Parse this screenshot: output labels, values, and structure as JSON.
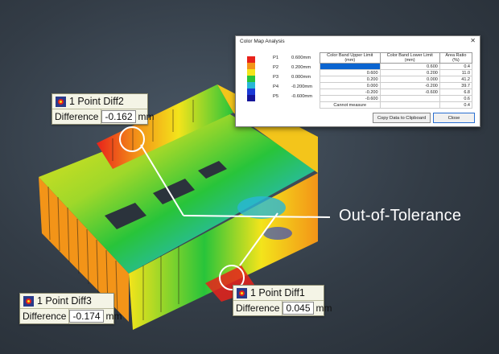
{
  "colors": {
    "background": "#333c46",
    "band_red": "#e8221b",
    "band_orange": "#f39418",
    "band_yellow": "#f3e41b",
    "band_green": "#28c43a",
    "band_cyan": "#28b7d6",
    "band_blue": "#1b3ad6",
    "band_navy": "#15159a",
    "callout_bg": "#f4f4e6"
  },
  "annotation": {
    "label": "Out-of-Tolerance"
  },
  "callouts": [
    {
      "title": "1 Point Diff2",
      "label": "Difference",
      "value": "-0.162",
      "unit": "mm"
    },
    {
      "title": "1 Point Diff3",
      "label": "Difference",
      "value": "-0.174",
      "unit": "mm"
    },
    {
      "title": "1 Point Diff1",
      "label": "Difference",
      "value": "0.045",
      "unit": "mm"
    }
  ],
  "dialog": {
    "title": "Color Map Analysis",
    "close_icon": "close-icon",
    "bands": [
      {
        "name": "P1",
        "value": "0.600mm"
      },
      {
        "name": "P2",
        "value": "0.200mm"
      },
      {
        "name": "P3",
        "value": "0.000mm"
      },
      {
        "name": "P4",
        "value": "-0.200mm"
      },
      {
        "name": "P5",
        "value": "-0.600mm"
      }
    ],
    "table": {
      "headers": [
        "Color Band Upper Limit (mm)",
        "Color Band Lower Limit (mm)",
        "Area Ratio (%)"
      ],
      "rows": [
        [
          "",
          "0.600",
          "0.4"
        ],
        [
          "0.600",
          "0.200",
          "11.0"
        ],
        [
          "0.200",
          "0.000",
          "41.2"
        ],
        [
          "0.000",
          "-0.200",
          "39.7"
        ],
        [
          "-0.200",
          "-0.600",
          "6.8"
        ],
        [
          "-0.600",
          "",
          "0.6"
        ],
        [
          "Cannot measure",
          "",
          "0.4"
        ]
      ]
    },
    "buttons": {
      "copy": "Copy Data to Clipboard",
      "close": "Close"
    }
  }
}
